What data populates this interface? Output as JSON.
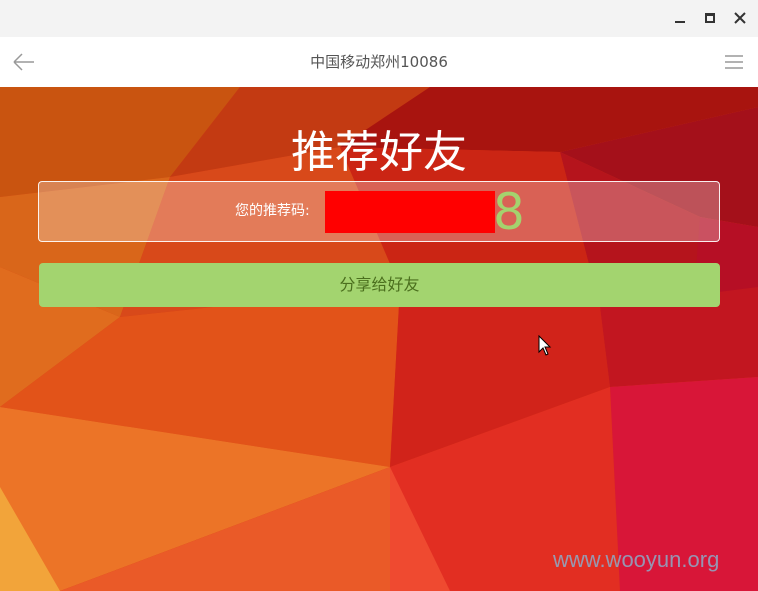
{
  "window": {
    "minimize_icon": "minimize-icon",
    "maximize_icon": "maximize-icon",
    "close_icon": "close-icon"
  },
  "nav": {
    "title": "中国移动郑州10086",
    "back_icon": "arrow-left-icon",
    "menu_icon": "hamburger-menu-icon"
  },
  "page": {
    "headline": "推荐好友",
    "code_label": "您的推荐码:",
    "code_visible_digit": "8",
    "share_button": "分享给好友",
    "watermark": "www.wooyun.org"
  },
  "colors": {
    "share_button_bg": "#a3d46f",
    "code_digit": "#a4d26e",
    "redaction": "#ff0000"
  }
}
